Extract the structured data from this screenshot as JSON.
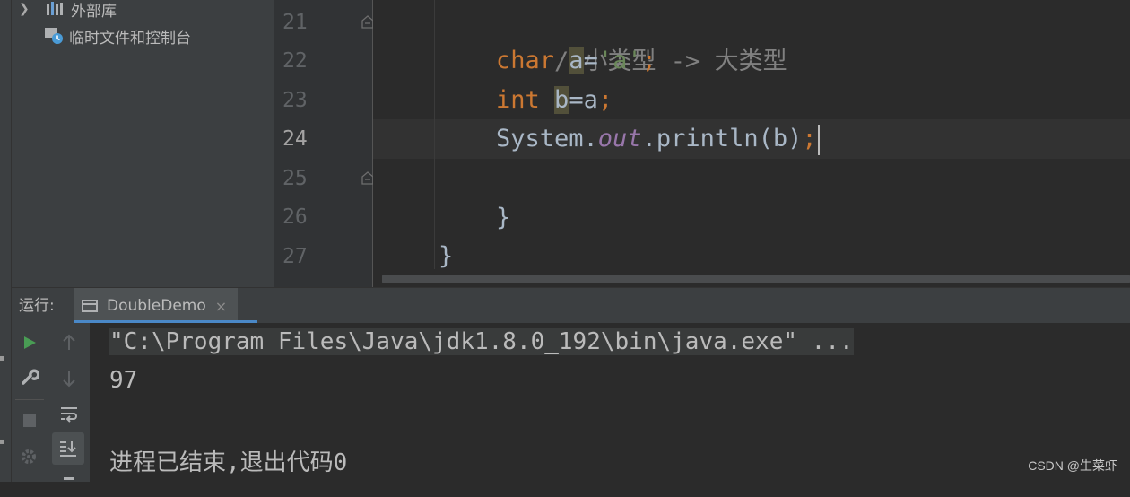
{
  "project_tree": {
    "items": [
      {
        "label": "外部库",
        "icon": "library-icon",
        "expandable": true
      },
      {
        "label": "临时文件和控制台",
        "icon": "scratches-icon",
        "expandable": false
      }
    ]
  },
  "editor": {
    "line_numbers": [
      "21",
      "22",
      "23",
      "24",
      "25",
      "26",
      "27"
    ],
    "current_line": "24",
    "lines": {
      "l21": "//小类型 -> 大类型",
      "l22": {
        "kw": "char",
        "var": "a",
        "op": "=",
        "str": "'a'",
        "semi": ";"
      },
      "l23": {
        "kw": "int",
        "var": "b",
        "rest": "=a",
        "semi": ";"
      },
      "l24": {
        "cls": "System.",
        "fld": "out",
        "call": ".println(b)",
        "semi": ";"
      },
      "l25": "}",
      "l26": "}"
    }
  },
  "run_window": {
    "label": "运行:",
    "tab_label": "DoubleDemo",
    "tab_close": "×"
  },
  "console": {
    "command": "\"C:\\Program Files\\Java\\jdk1.8.0_192\\bin\\java.exe\" ...",
    "output": "97",
    "exit_message": "进程已结束,退出代码0"
  },
  "watermark": "CSDN @生菜虾",
  "colors": {
    "keyword": "#cc7832",
    "string": "#6a8759",
    "comment": "#808080",
    "field": "#9876aa",
    "run_green": "#499c54",
    "tab_underline": "#4a88c7"
  }
}
